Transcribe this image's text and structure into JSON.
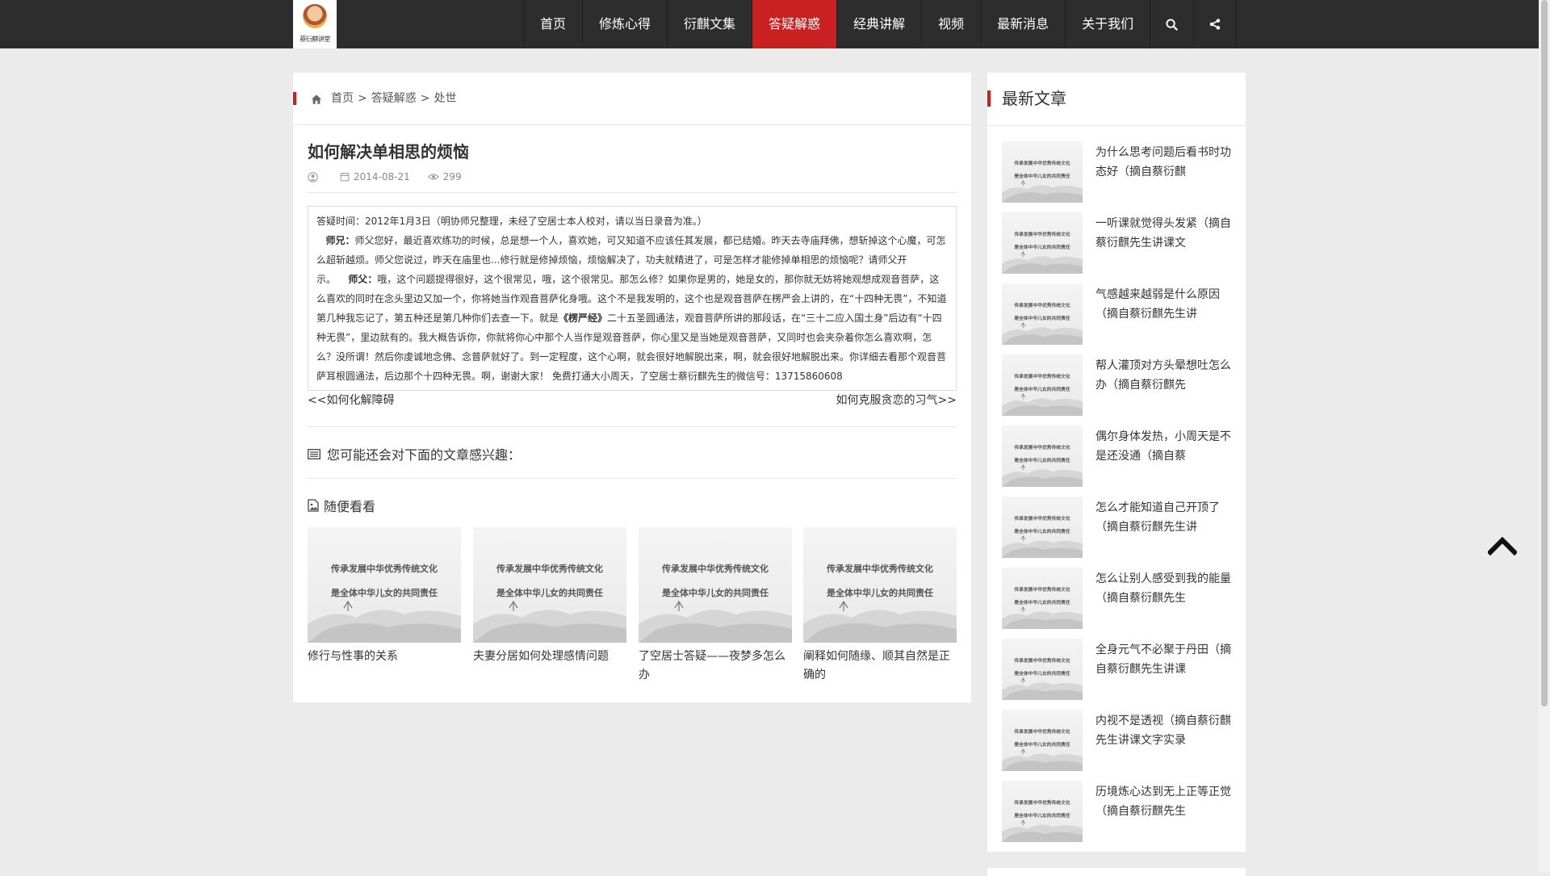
{
  "logo": {
    "text": "蔡衍麒讲堂"
  },
  "nav": {
    "items": [
      {
        "label": "首页"
      },
      {
        "label": "修炼心得"
      },
      {
        "label": "衍麒文集"
      },
      {
        "label": "答疑解惑",
        "active": true
      },
      {
        "label": "经典讲解"
      },
      {
        "label": "视频"
      },
      {
        "label": "最新消息"
      },
      {
        "label": "关于我们"
      }
    ],
    "icons": [
      "search-icon",
      "share-icon"
    ]
  },
  "colors": {
    "accent": "#c92122",
    "nav_bg": "#2d2d2d",
    "page_bg": "#ebebeb"
  },
  "breadcrumb": {
    "home": "首页",
    "sep": ">",
    "category": "答疑解惑",
    "sub": "处世"
  },
  "article": {
    "title": "如何解决单相思的烦恼",
    "date": "2014-08-21",
    "views": "299",
    "p1": "答疑时间：2012年1月3日（明协师兄整理，未经了空居士本人校对，请以当日录音为准。）",
    "speaker_q": "师兄：",
    "q": "师父您好，最近喜欢练功的时候，总是想一个人，喜欢她，可又知道不应该任其发展，都已结婚。昨天去寺庙拜佛，想斩掉这个心魔，可怎么超斩越烦。师父您说过，昨天在庙里也...修行就是修掉烦恼，烦恼解决了，功夫就精进了，可是怎样才能修掉单相思的烦恼呢？请师父开示。",
    "speaker_a": "师父：",
    "a1": "哦，这个问题提得很好，这个很常见，哦，这个很常见。那怎么修？如果你是男的，她是女的，那你就无妨将她观想成观音菩萨，这么喜欢的同时在念头里边又加一个，你将她当作观音菩萨化身哦。这个不是我发明的，这个也是观音菩萨在楞严会上讲的，在“十四种无畏”，不知道第几种我忘记了，第五种还是第几种你们去查一下。就是",
    "sutra": "《楞严经》",
    "a2": "二十五圣圆通法，观音菩萨所讲的那段话，在“三十二应入国土身”后边有“十四种无畏”，里边就有的。我大概告诉你，你就将你心中那个人当作是观音菩萨，你心里又是当她是观音菩萨，又同时也会夹杂着你怎么喜欢啊，怎么？没所谓！然后你虔诚地念佛、念普萨就好了。到一定程度，这个心啊，就会很好地解脱出来，啊，就会很好地解脱出来。你详细去看那个观音菩萨耳根圆通法，后边那个十四种无畏。啊，谢谢大家！ 免费打通大小周天，了空居士蔡衍麒先生的微信号：13715860608"
  },
  "prevnext": {
    "prev": "<<如何化解障碍",
    "next": "如何克服贪恋的习气>>"
  },
  "related": {
    "heading": "您可能还会对下面的文章感兴趣：",
    "random_heading": "随便看看",
    "items": [
      {
        "title": "修行与性事的关系"
      },
      {
        "title": "夫妻分居如何处理感情问题"
      },
      {
        "title": "了空居士答疑——夜梦多怎么办"
      },
      {
        "title": "阐释如何随缘、顺其自然是正确的"
      }
    ]
  },
  "thumb_text": {
    "line1": "传承发展中华优秀传统文化",
    "line2": "是全体中华儿女的共同责任"
  },
  "sidebar": {
    "title": "最新文章",
    "items": [
      {
        "title": "为什么思考问题后看书时功态好（摘自蔡衍麒"
      },
      {
        "title": "一听课就觉得头发紧（摘自蔡衍麒先生讲课文"
      },
      {
        "title": "气感越来越弱是什么原因（摘自蔡衍麒先生讲"
      },
      {
        "title": "帮人灌顶对方头晕想吐怎么办（摘自蔡衍麒先"
      },
      {
        "title": "偶尔身体发热，小周天是不是还没通（摘自蔡"
      },
      {
        "title": "怎么才能知道自己开顶了（摘自蔡衍麒先生讲"
      },
      {
        "title": "怎么让别人感受到我的能量（摘自蔡衍麒先生"
      },
      {
        "title": "全身元气不必聚于丹田（摘自蔡衍麒先生讲课"
      },
      {
        "title": "内视不是透视（摘自蔡衍麒先生讲课文字实录"
      },
      {
        "title": "历境炼心达到无上正等正觉（摘自蔡衍麒先生"
      }
    ]
  }
}
